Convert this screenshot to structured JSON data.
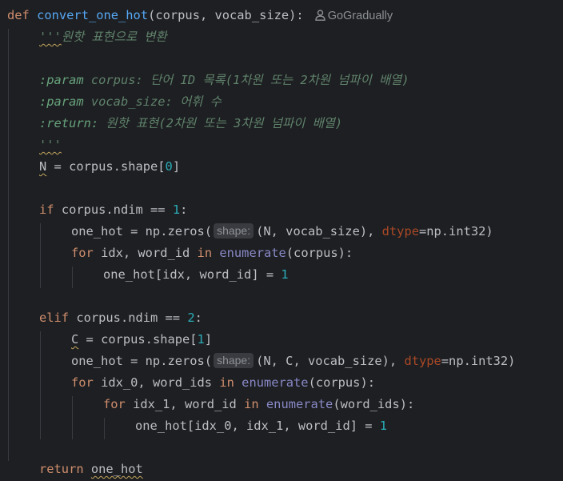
{
  "code": {
    "def_kw": "def",
    "func_name": "convert_one_hot",
    "signature_rest": "(corpus, vocab_size):",
    "author": "GoGradually",
    "doc_open": "'''",
    "doc_summary": "원핫 표현으로 변환",
    "doc_param1_tag": ":param",
    "doc_param1_text": " corpus: 단어 ID 목록(1차원 또는 2차원 넘파이 배열)",
    "doc_param2_tag": ":param",
    "doc_param2_text": " vocab_size: 어휘 수",
    "doc_return_tag": ":return:",
    "doc_return_text": " 원핫 표현(2차원 또는 3차원 넘파이 배열)",
    "doc_close": "'''",
    "n_var": "N",
    "n_rest": " = corpus.shape[",
    "n_idx": "0",
    "n_end": "]",
    "if_kw": "if",
    "if_cond": " corpus.ndim == ",
    "if_num": "1",
    "if_end": ":",
    "oh1_start": "one_hot = np.zeros(",
    "hint_label": "shape:",
    "oh1_args": "(N, vocab_size), ",
    "dtype_kw": "dtype",
    "dtype_val": "=np.int32)",
    "for_kw": "for",
    "for1_vars": " idx, word_id ",
    "in_kw": "in",
    "enumerate_fn": "enumerate",
    "for1_end": "(corpus):",
    "assign1": "one_hot[idx, word_id] = ",
    "assign1_num": "1",
    "elif_kw": "elif",
    "elif_cond": " corpus.ndim == ",
    "elif_num": "2",
    "elif_end": ":",
    "c_var": "C",
    "c_rest": " = corpus.shape[",
    "c_idx": "1",
    "c_end": "]",
    "oh2_args": "(N, C, vocab_size), ",
    "for2_vars": " idx_0, word_ids ",
    "for2_end": "(corpus):",
    "for3_vars": " idx_1, word_id ",
    "for3_end": "(word_ids):",
    "assign2": "one_hot[idx_0, idx_1, word_id] = ",
    "assign2_num": "1",
    "return_kw": "return",
    "return_val": "one_hot"
  },
  "colors": {
    "background": "#1e1f22",
    "keyword": "#cf8e6d",
    "function": "#56a8f5",
    "number": "#2aacb8",
    "docstring": "#5f826b",
    "builtin": "#8888c6",
    "parameter": "#aa4926"
  },
  "icons": {
    "author": "person-icon"
  }
}
